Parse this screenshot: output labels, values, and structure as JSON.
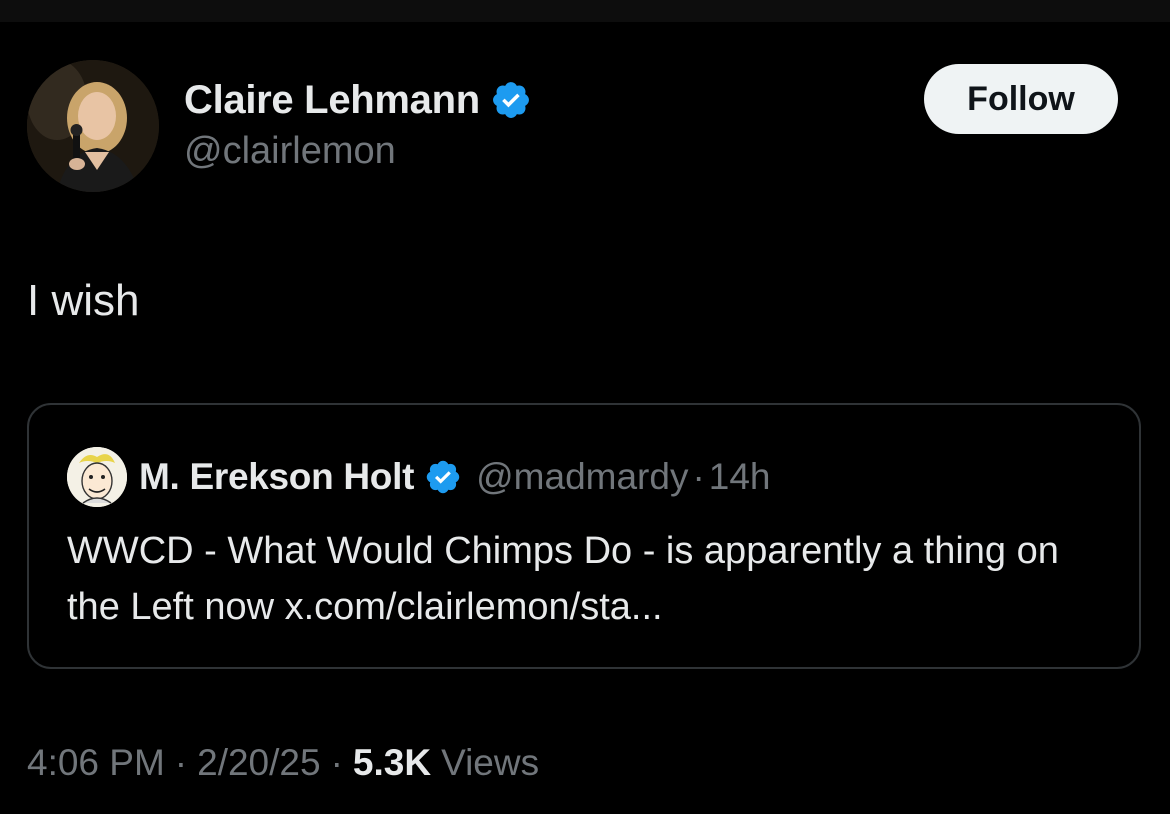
{
  "author": {
    "name": "Claire Lehmann",
    "handle": "@clairlemon",
    "verified": true
  },
  "follow_button": {
    "label": "Follow"
  },
  "tweet": {
    "text": "I wish"
  },
  "quoted_tweet": {
    "name": "M. Erekson Holt",
    "handle": "@madmardy",
    "separator": "·",
    "time": "14h",
    "verified": true,
    "text": "WWCD - What Would Chimps Do - is apparently a thing on the Left now x.com/clairlemon/sta..."
  },
  "meta": {
    "time": "4:06 PM",
    "date": "2/20/25",
    "separator": "·",
    "views_count": "5.3K",
    "views_label": "Views"
  },
  "colors": {
    "background": "#000000",
    "text_primary": "#e7e9ea",
    "text_secondary": "#71767b",
    "verified_blue": "#1d9bf0",
    "border": "#2f3336",
    "follow_bg": "#eff3f4"
  },
  "icons": {
    "verified": "verified-badge-icon"
  }
}
